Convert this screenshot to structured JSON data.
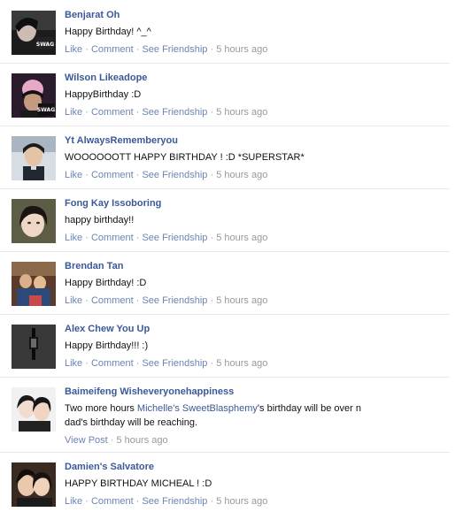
{
  "separator": " · ",
  "posts": [
    {
      "author": "Benjarat Oh",
      "message": "Happy Birthday! ^_^",
      "actions": {
        "like": "Like",
        "comment": "Comment",
        "friendship": "See Friendship"
      },
      "time": "5 hours ago",
      "avatar_overlay": "SWAG"
    },
    {
      "author": "Wilson Likeadope",
      "message": "HappyBirthday :D",
      "actions": {
        "like": "Like",
        "comment": "Comment",
        "friendship": "See Friendship"
      },
      "time": "5 hours ago",
      "avatar_overlay": "SWAG"
    },
    {
      "author": "Yt AlwaysRememberyou",
      "message": "WOOOOOOTT HAPPY BIRTHDAY ! :D *SUPERSTAR*",
      "actions": {
        "like": "Like",
        "comment": "Comment",
        "friendship": "See Friendship"
      },
      "time": "5 hours ago"
    },
    {
      "author": "Fong Kay Issoboring",
      "message": "happy birthday!!",
      "actions": {
        "like": "Like",
        "comment": "Comment",
        "friendship": "See Friendship"
      },
      "time": "5 hours ago"
    },
    {
      "author": "Brendan Tan",
      "message": "Happy Birthday! :D",
      "actions": {
        "like": "Like",
        "comment": "Comment",
        "friendship": "See Friendship"
      },
      "time": "5 hours ago"
    },
    {
      "author": "Alex Chew You Up",
      "message": "Happy Birthday!!! :)",
      "actions": {
        "like": "Like",
        "comment": "Comment",
        "friendship": "See Friendship"
      },
      "time": "5 hours ago"
    },
    {
      "author": "Baimeifeng Wisheveryonehappiness",
      "message_prefix": "Two more hours ",
      "mention": "Michelle's SweetBlasphemy",
      "message_suffix_line1": "'s birthday will be over n",
      "message_line2": "dad's birthday will be reaching.",
      "actions": {
        "view_post": "View Post"
      },
      "time": "5 hours ago"
    },
    {
      "author": "Damien's Salvatore",
      "message": "HAPPY BIRTHDAY MICHEAL ! :D",
      "actions": {
        "like": "Like",
        "comment": "Comment",
        "friendship": "See Friendship"
      },
      "time": "5 hours ago"
    }
  ]
}
